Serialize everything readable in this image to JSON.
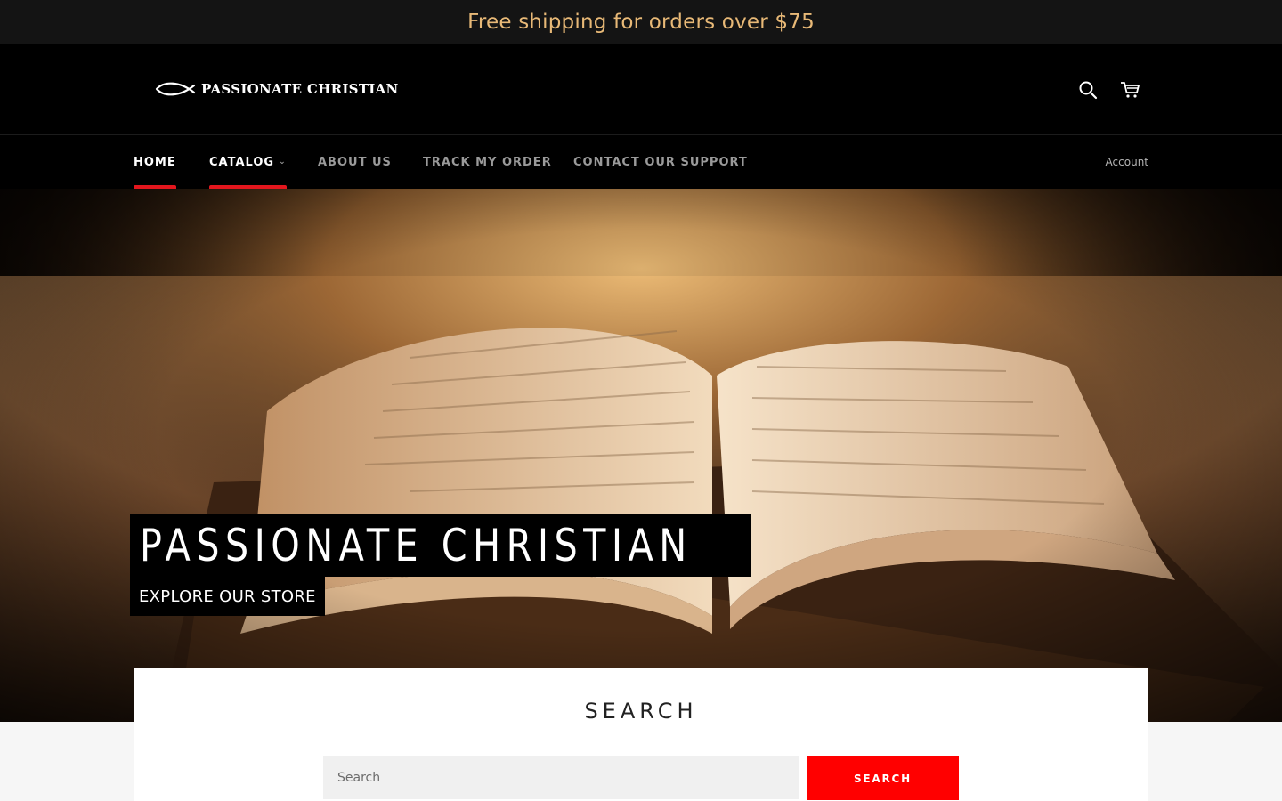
{
  "announcement": {
    "text": "Free shipping for orders over $75"
  },
  "header": {
    "logo_text": "PASSIONATE CHRISTIAN",
    "logo_icon": "ichthys-fish-icon",
    "search_icon": "search-icon",
    "cart_icon": "cart-icon"
  },
  "nav": {
    "items": [
      {
        "label": "HOME",
        "active": true
      },
      {
        "label": "CATALOG",
        "active": true,
        "has_dropdown": true
      },
      {
        "label": "ABOUT US",
        "active": false
      },
      {
        "label": "TRACK MY ORDER",
        "active": false
      },
      {
        "label": "CONTACT OUR SUPPORT",
        "active": false
      }
    ],
    "account_label": "Account"
  },
  "hero": {
    "title": "PASSIONATE CHRISTIAN",
    "button_label": "EXPLORE OUR STORE"
  },
  "search": {
    "heading": "SEARCH",
    "placeholder": "Search",
    "button_label": "SEARCH"
  },
  "colors": {
    "announcement_bg": "#141414",
    "announcement_text": "#e8b977",
    "nav_active_underline": "#e3161d",
    "search_button": "#ff0000"
  }
}
